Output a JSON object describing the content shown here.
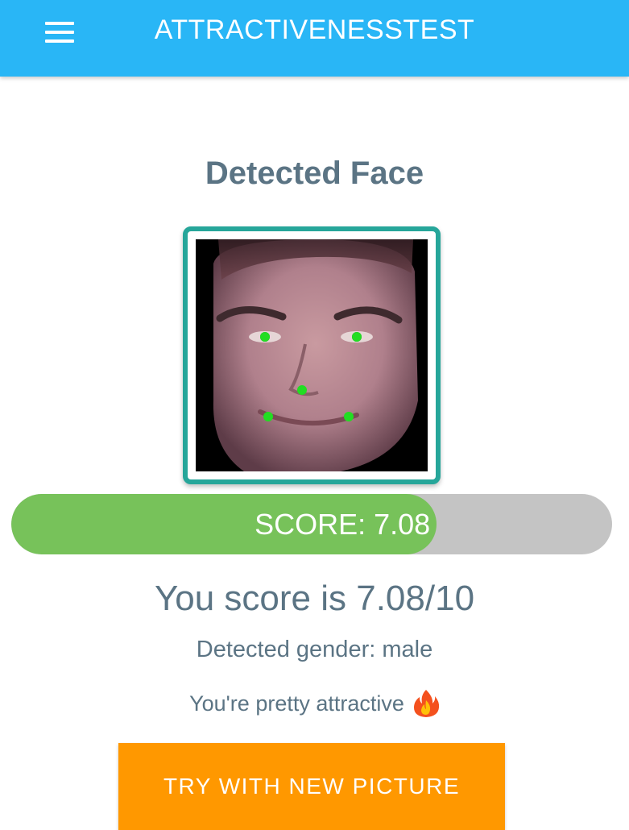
{
  "appbar": {
    "title": "ATTRACTIVENESSTEST",
    "menu_icon": "hamburger-menu-icon"
  },
  "face_section": {
    "title": "Detected Face"
  },
  "score_bar": {
    "label": "SCORE: 7.08",
    "value": 7.08,
    "max": 10
  },
  "result": {
    "score_text": "You score is 7.08/10",
    "gender_text": "Detected gender: male",
    "verdict_text": "You're pretty attractive",
    "verdict_icon": "fire-icon"
  },
  "actions": {
    "retry_label": "TRY WITH NEW PICTURE"
  },
  "colors": {
    "appbar": "#29b6f6",
    "frame": "#26a69a",
    "score_fill": "#77c25a",
    "score_track": "#c4c4c4",
    "text": "#5b7484",
    "cta": "#ff9800",
    "landmark": "#22dd22"
  }
}
